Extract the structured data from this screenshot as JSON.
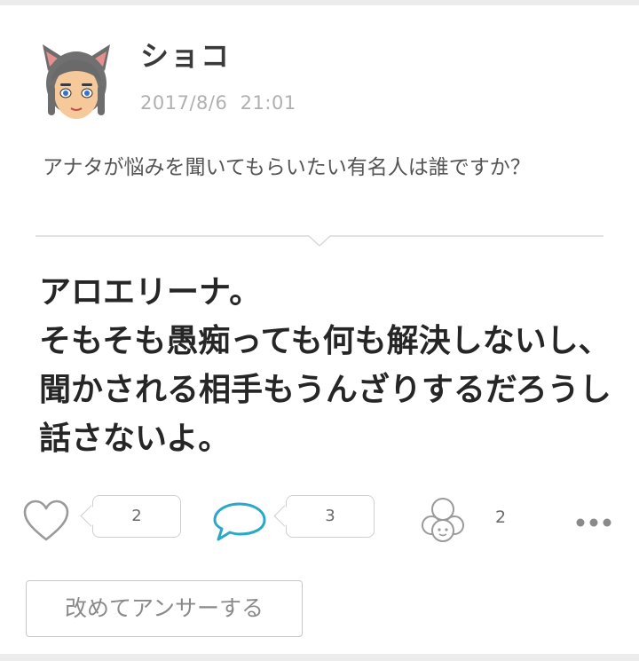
{
  "post": {
    "user_name": "ショコ",
    "timestamp": "2017/8/6  21:01",
    "question": "アナタが悩みを聞いてもらいたい有名人は誰ですか？",
    "answer": "アロエリーナ。\nそもそも愚痴っても何も解決しないし、聞かされる相手もうんざりするだろうし話さないよ。"
  },
  "actions": {
    "like_count": "2",
    "comment_count": "3",
    "empathy_count": "2"
  },
  "icons": {
    "like": "heart-icon",
    "comment": "speech-bubble-icon",
    "empathy": "mii-group-icon",
    "more": "more-options-icon"
  },
  "buttons": {
    "answer_again": "改めてアンサーする"
  },
  "colors": {
    "accent": "#2aa8c8",
    "muted_text": "#b0b0b0",
    "border": "#cfcfcf"
  }
}
